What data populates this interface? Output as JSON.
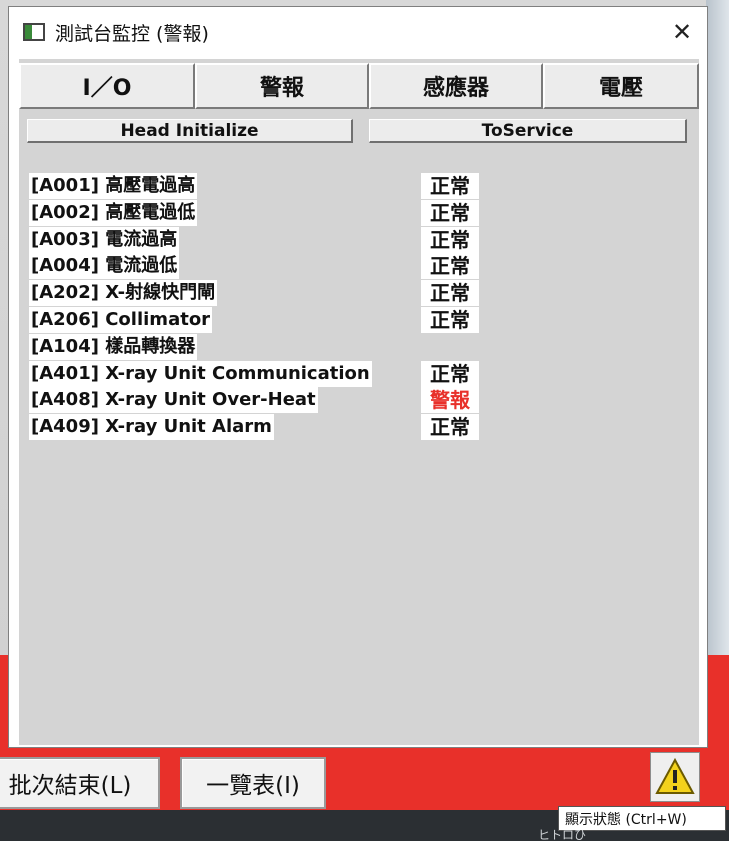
{
  "window": {
    "title": "測試台監控 (警報)",
    "close_glyph": "✕"
  },
  "tabs": [
    {
      "label": "I／O"
    },
    {
      "label": "警報"
    },
    {
      "label": "感應器"
    },
    {
      "label": "電壓"
    }
  ],
  "actions": {
    "head_initialize": "Head Initialize",
    "to_service": "ToService"
  },
  "alarms": [
    {
      "label": "[A001] 高壓電過高",
      "status": "正常",
      "status_color": "#111111"
    },
    {
      "label": "[A002] 高壓電過低",
      "status": "正常",
      "status_color": "#111111"
    },
    {
      "label": "[A003] 電流過高",
      "status": "正常",
      "status_color": "#111111"
    },
    {
      "label": "[A004] 電流過低",
      "status": "正常",
      "status_color": "#111111"
    },
    {
      "label": "[A202] X-射線快門閘",
      "status": "正常",
      "status_color": "#111111"
    },
    {
      "label": "[A206] Collimator",
      "status": "正常",
      "status_color": "#111111"
    },
    {
      "label": "[A104] 樣品轉換器",
      "status": "",
      "status_color": "#111111"
    },
    {
      "label": "[A401] X-ray Unit Communication",
      "status": "正常",
      "status_color": "#111111"
    },
    {
      "label": "[A408] X-ray Unit Over-Heat",
      "status": "警報",
      "status_color": "#e8302a"
    },
    {
      "label": "[A409] X-ray Unit Alarm",
      "status": "正常",
      "status_color": "#111111"
    }
  ],
  "background": {
    "batch_end_button": "批次結束(L)",
    "list_button": "一覽表(I)",
    "tooltip": "顯示狀態 (Ctrl+W)",
    "corner_text": "ヒトロひ"
  },
  "colors": {
    "alarm_red": "#e8302a",
    "warning_yellow": "#f3d21c"
  }
}
